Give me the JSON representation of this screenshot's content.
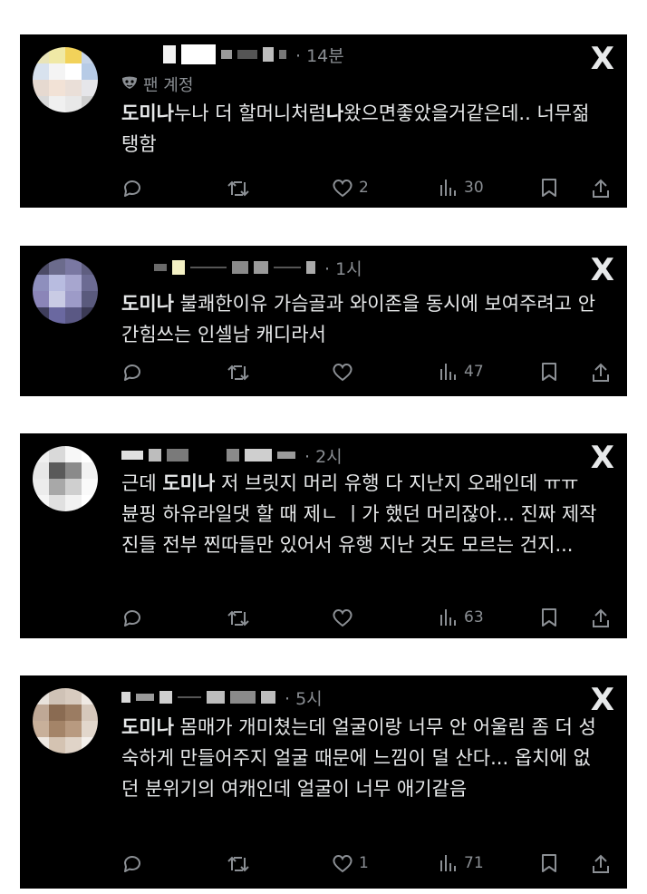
{
  "comments": [
    {
      "time": "14분",
      "fan_label": "팬 계정",
      "text_bold": "도미나",
      "text": "누나 더 할머니처럼",
      "text_bold2": "나",
      "text_rest": "왔으면좋았을거같은데.. 너무젊탱함",
      "likes": "2",
      "views": "30"
    },
    {
      "time": "1시",
      "text_bold": "도미나",
      "text": " 불쾌한이유 가슴골과 와이존을 동시에 보여주려고 안간힘쓰는 인셀남 캐디라서",
      "likes": "",
      "views": "47"
    },
    {
      "time": "2시",
      "text_pre": "근데 ",
      "text_bold": "도미나",
      "text": " 저 브릿지 머리 유행 다 지난지 오래인데 ㅠㅠ 뷴핑 하유라일댓 할 때 제ㄴ ㅣ가 했던 머리잖아... 진짜 제작진들 전부 찐따들만 있어서 유행 지난 것도 모르는 건지...",
      "likes": "",
      "views": "63"
    },
    {
      "time": "5시",
      "text_bold": "도미나",
      "text": " 몸매가 개미쳤는데 얼굴이랑 너무 안 어울림 좀 더 성숙하게 만들어주지 얼굴 때문에 느낌이 덜 산다... 옵치에 없던 분위기의 여캐인데 얼굴이 너무 애기같음",
      "likes": "1",
      "views": "71"
    }
  ],
  "icons": {
    "x_logo": "X",
    "reply": "reply-icon",
    "repost": "repost-icon",
    "like": "heart-icon",
    "views": "views-icon",
    "bookmark": "bookmark-icon",
    "share": "share-icon"
  },
  "colors": {
    "card_bg": "#000000",
    "text": "#e7e9ea",
    "muted": "#8b8f94"
  }
}
